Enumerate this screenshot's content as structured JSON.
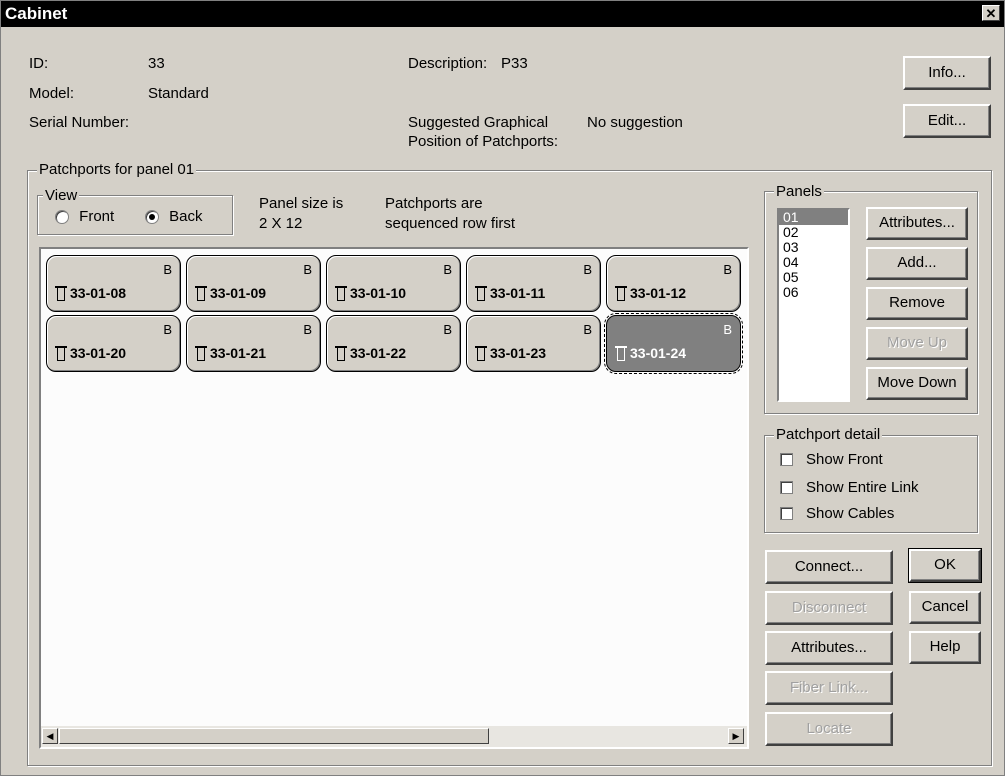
{
  "window": {
    "title": "Cabinet",
    "close_glyph": "✕"
  },
  "info": {
    "id_label": "ID:",
    "id_value": "33",
    "model_label": "Model:",
    "model_value": "Standard",
    "serial_label": "Serial Number:",
    "serial_value": "",
    "description_label": "Description:",
    "description_value": "P33",
    "suggested_label_line1": "Suggested Graphical",
    "suggested_label_line2": "Position of Patchports:",
    "suggested_value": "No suggestion"
  },
  "top_buttons": {
    "info": "Info...",
    "edit": "Edit..."
  },
  "patchports": {
    "group_label": "Patchports for panel 01",
    "view_label": "View",
    "view_front": "Front",
    "view_back": "Back",
    "view_selected": "Back",
    "panel_size_line1": "Panel size is",
    "panel_size_line2": "2 X 12",
    "sequence_line1": "Patchports are",
    "sequence_line2": "sequenced row first",
    "ports_row1": [
      {
        "label": "33-01-08",
        "side": "B"
      },
      {
        "label": "33-01-09",
        "side": "B"
      },
      {
        "label": "33-01-10",
        "side": "B"
      },
      {
        "label": "33-01-11",
        "side": "B"
      },
      {
        "label": "33-01-12",
        "side": "B"
      }
    ],
    "ports_row2": [
      {
        "label": "33-01-20",
        "side": "B"
      },
      {
        "label": "33-01-21",
        "side": "B"
      },
      {
        "label": "33-01-22",
        "side": "B"
      },
      {
        "label": "33-01-23",
        "side": "B"
      },
      {
        "label": "33-01-24",
        "side": "B",
        "selected": true
      }
    ]
  },
  "panels": {
    "group_label": "Panels",
    "items": [
      "01",
      "02",
      "03",
      "04",
      "05",
      "06"
    ],
    "selected": "01",
    "buttons": {
      "attributes": "Attributes...",
      "add": "Add...",
      "remove": "Remove",
      "move_up": "Move Up",
      "move_down": "Move Down"
    }
  },
  "patchport_detail": {
    "group_label": "Patchport detail",
    "show_front": "Show Front",
    "show_entire_link": "Show Entire Link",
    "show_cables": "Show Cables"
  },
  "actions": {
    "connect": "Connect...",
    "disconnect": "Disconnect",
    "attributes": "Attributes...",
    "fiber_link": "Fiber Link...",
    "locate": "Locate",
    "ok": "OK",
    "cancel": "Cancel",
    "help": "Help"
  },
  "icons": [
    "close-icon",
    "patchport-plug-icon",
    "scroll-left-icon",
    "scroll-right-icon"
  ]
}
